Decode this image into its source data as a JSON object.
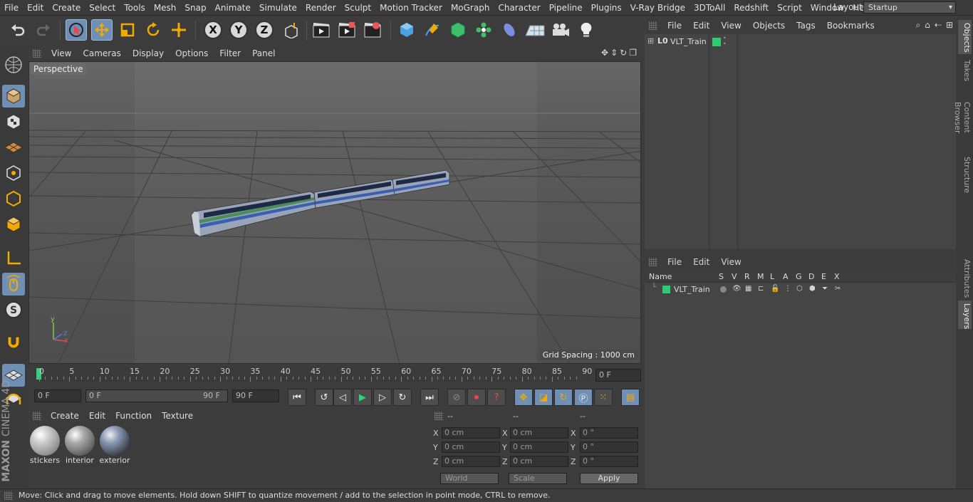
{
  "menubar": {
    "items": [
      "File",
      "Edit",
      "Create",
      "Select",
      "Tools",
      "Mesh",
      "Snap",
      "Animate",
      "Simulate",
      "Render",
      "Sculpt",
      "Motion Tracker",
      "MoGraph",
      "Character",
      "Pipeline",
      "Plugins",
      "V-Ray Bridge",
      "3DToAll",
      "Redshift",
      "Script",
      "Window",
      "Help"
    ],
    "layout_label": "Layout:",
    "layout_value": "Startup"
  },
  "toolbar": {
    "axis_x": "X",
    "axis_y": "Y",
    "axis_z": "Z"
  },
  "left_toolbar": {
    "brand_top": "MAXON",
    "brand_bottom": "CINEMA 4D"
  },
  "viewport": {
    "menu": [
      "View",
      "Cameras",
      "Display",
      "Options",
      "Filter",
      "Panel"
    ],
    "camera_label": "Perspective",
    "grid_spacing": "Grid Spacing : 1000 cm",
    "axis_x": "x",
    "axis_y": "y",
    "axis_z": "z"
  },
  "timeline": {
    "ticks": [
      "0",
      "5",
      "10",
      "15",
      "20",
      "25",
      "30",
      "35",
      "40",
      "45",
      "50",
      "55",
      "60",
      "65",
      "70",
      "75",
      "80",
      "85",
      "90"
    ],
    "current_frame": "0 F"
  },
  "transport": {
    "start_field": "0 F",
    "range_start": "0 F",
    "range_end": "90 F",
    "end_field": "90 F"
  },
  "material_manager": {
    "menu": [
      "Create",
      "Edit",
      "Function",
      "Texture"
    ],
    "materials": [
      "stickers",
      "interior",
      "exterior"
    ]
  },
  "coordinates": {
    "headers": [
      "--",
      "--",
      "--"
    ],
    "rows": [
      {
        "l1": "X",
        "v1": "0 cm",
        "l2": "X",
        "v2": "0 cm",
        "l3": "X",
        "v3": "0 °"
      },
      {
        "l1": "Y",
        "v1": "0 cm",
        "l2": "Y",
        "v2": "0 cm",
        "l3": "Y",
        "v3": "0 °"
      },
      {
        "l1": "Z",
        "v1": "0 cm",
        "l2": "Z",
        "v2": "0 cm",
        "l3": "Z",
        "v3": "0 °"
      }
    ],
    "space_dropdown": "World",
    "mode_dropdown": "Scale",
    "apply_label": "Apply"
  },
  "object_manager": {
    "menu": [
      "File",
      "Edit",
      "View",
      "Objects",
      "Tags",
      "Bookmarks"
    ],
    "objects": [
      {
        "name": "VLT_Train",
        "color": "#2ecc71"
      }
    ]
  },
  "layer_manager": {
    "menu": [
      "File",
      "Edit",
      "View"
    ],
    "columns": [
      "Name",
      "S",
      "V",
      "R",
      "M",
      "L",
      "A",
      "G",
      "D",
      "E",
      "X"
    ],
    "layers": [
      {
        "name": "VLT_Train",
        "color": "#2ecc71"
      }
    ]
  },
  "right_tabs": [
    "Objects",
    "Takes",
    "Content Browser",
    "Structure",
    "Attributes",
    "Layers"
  ],
  "status_bar": {
    "text": "Move: Click and drag to move elements. Hold down SHIFT to quantize movement / add to the selection in point mode, CTRL to remove."
  },
  "colors": {
    "accent": "#6f8fb5",
    "layer_green": "#2ecc71",
    "bg": "#3c3c3c"
  }
}
